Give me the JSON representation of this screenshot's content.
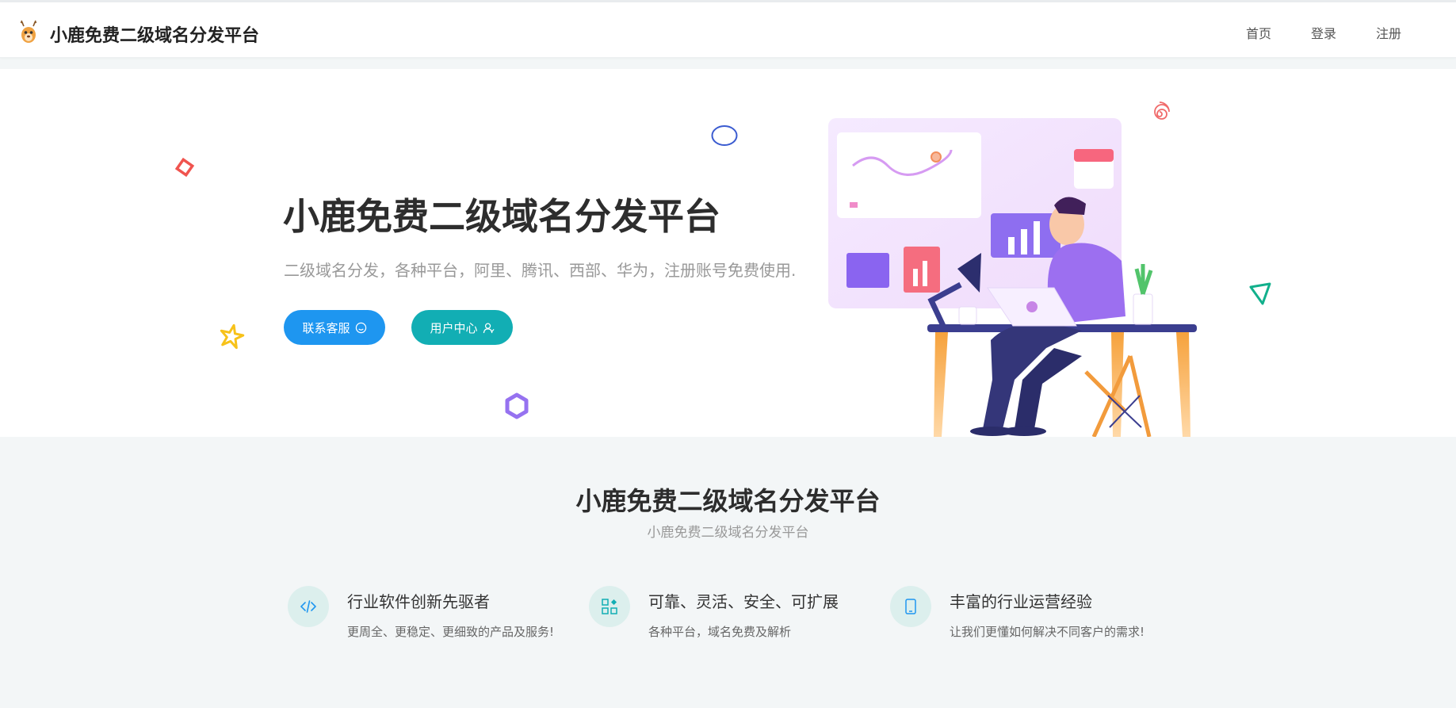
{
  "header": {
    "brand": "小鹿免费二级域名分发平台",
    "nav": [
      "首页",
      "登录",
      "注册"
    ]
  },
  "hero": {
    "title": "小鹿免费二级域名分发平台",
    "subtitle": "二级域名分发，各种平台，阿里、腾讯、西部、华为，注册账号免费使用.",
    "buttons": [
      {
        "label": "联系客服",
        "icon": "smile-icon",
        "color": "#1e96f0"
      },
      {
        "label": "用户中心",
        "icon": "user-icon",
        "color": "#12aeb4"
      }
    ]
  },
  "section": {
    "title": "小鹿免费二级域名分发平台",
    "subtitle": "小鹿免费二级域名分发平台"
  },
  "features": [
    {
      "icon": "code-icon",
      "title": "行业软件创新先驱者",
      "desc": "更周全、更稳定、更细致的产品及服务!"
    },
    {
      "icon": "grid-icon",
      "title": "可靠、灵活、安全、可扩展",
      "desc": "各种平台，域名免费及解析"
    },
    {
      "icon": "tablet-icon",
      "title": "丰富的行业运营经验",
      "desc": "让我们更懂如何解决不同客户的需求!"
    }
  ],
  "colors": {
    "primary": "#1e96f0",
    "teal": "#12aeb4",
    "icon_bg": "#dcefed"
  }
}
